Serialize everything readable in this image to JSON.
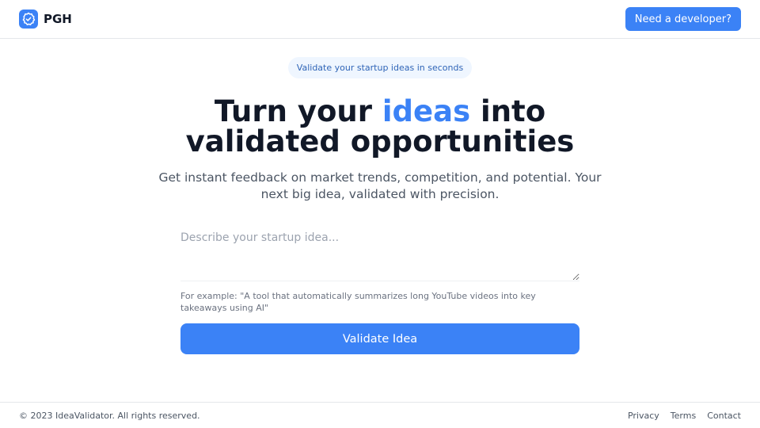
{
  "header": {
    "brand_name": "PGH",
    "logo_icon": "badge-check-icon",
    "cta_label": "Need a developer?"
  },
  "hero": {
    "badge": "Validate your startup ideas in seconds",
    "headline_part1": "Turn your ",
    "headline_accent": "ideas",
    "headline_part2": " into",
    "headline_line2": "validated opportunities",
    "subtitle": "Get instant feedback on market trends, competition, and potential. Your next big idea, validated with precision."
  },
  "form": {
    "idea_value": "",
    "idea_placeholder": "Describe your startup idea...",
    "hint": "For example: \"A tool that automatically summarizes long YouTube videos into key takeaways using AI\"",
    "submit_label": "Validate Idea"
  },
  "footer": {
    "copyright": "© 2023 IdeaValidator. All rights reserved.",
    "links": [
      {
        "label": "Privacy"
      },
      {
        "label": "Terms"
      },
      {
        "label": "Contact"
      }
    ]
  },
  "colors": {
    "accent": "#3b82f6",
    "text": "#111827",
    "muted": "#4b5563",
    "badge_bg": "#eff6ff"
  }
}
